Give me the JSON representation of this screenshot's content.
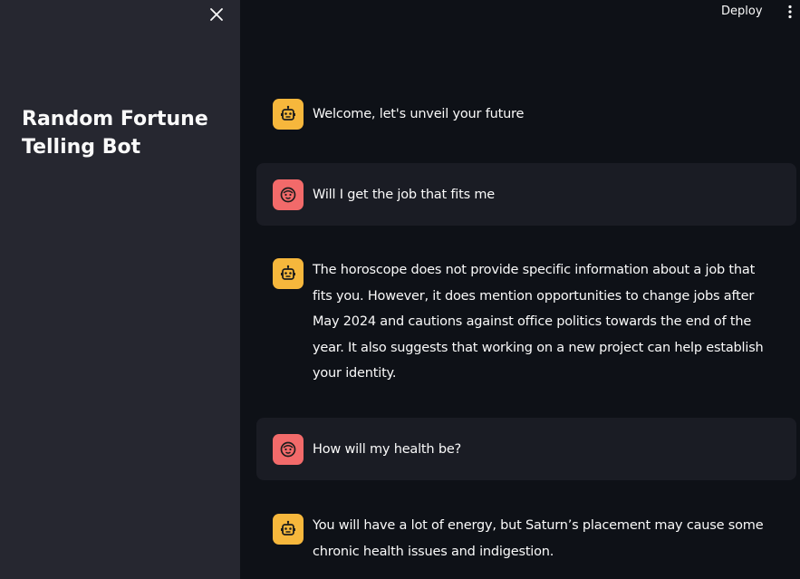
{
  "sidebar": {
    "title": "Random Fortune Telling Bot",
    "close_icon": "close-icon"
  },
  "header": {
    "deploy_label": "Deploy",
    "menu_icon": "vertical-ellipsis-icon"
  },
  "chat": {
    "messages": [
      {
        "role": "assistant",
        "avatar_icon": "robot-face-icon",
        "text": "Welcome, let's unveil your future"
      },
      {
        "role": "user",
        "avatar_icon": "smiley-face-icon",
        "text": "Will I get the job that fits me"
      },
      {
        "role": "assistant",
        "avatar_icon": "robot-face-icon",
        "text": "The horoscope does not provide specific information about a job that fits you. However, it does mention opportunities to change jobs after May 2024 and cautions against office politics towards the end of the year. It also suggests that working on a new project can help establish your identity."
      },
      {
        "role": "user",
        "avatar_icon": "smiley-face-icon",
        "text": "How will my health be?"
      },
      {
        "role": "assistant",
        "avatar_icon": "robot-face-icon",
        "text": "You will have a lot of energy, but Saturn’s placement may cause some chronic health issues and indigestion."
      }
    ]
  },
  "colors": {
    "background": "#0e1117",
    "sidebar": "#262730",
    "user_message_bg": "#1a1c24",
    "assistant_avatar": "#f6b73c",
    "user_avatar": "#f26a6a",
    "text": "#fafafa"
  }
}
